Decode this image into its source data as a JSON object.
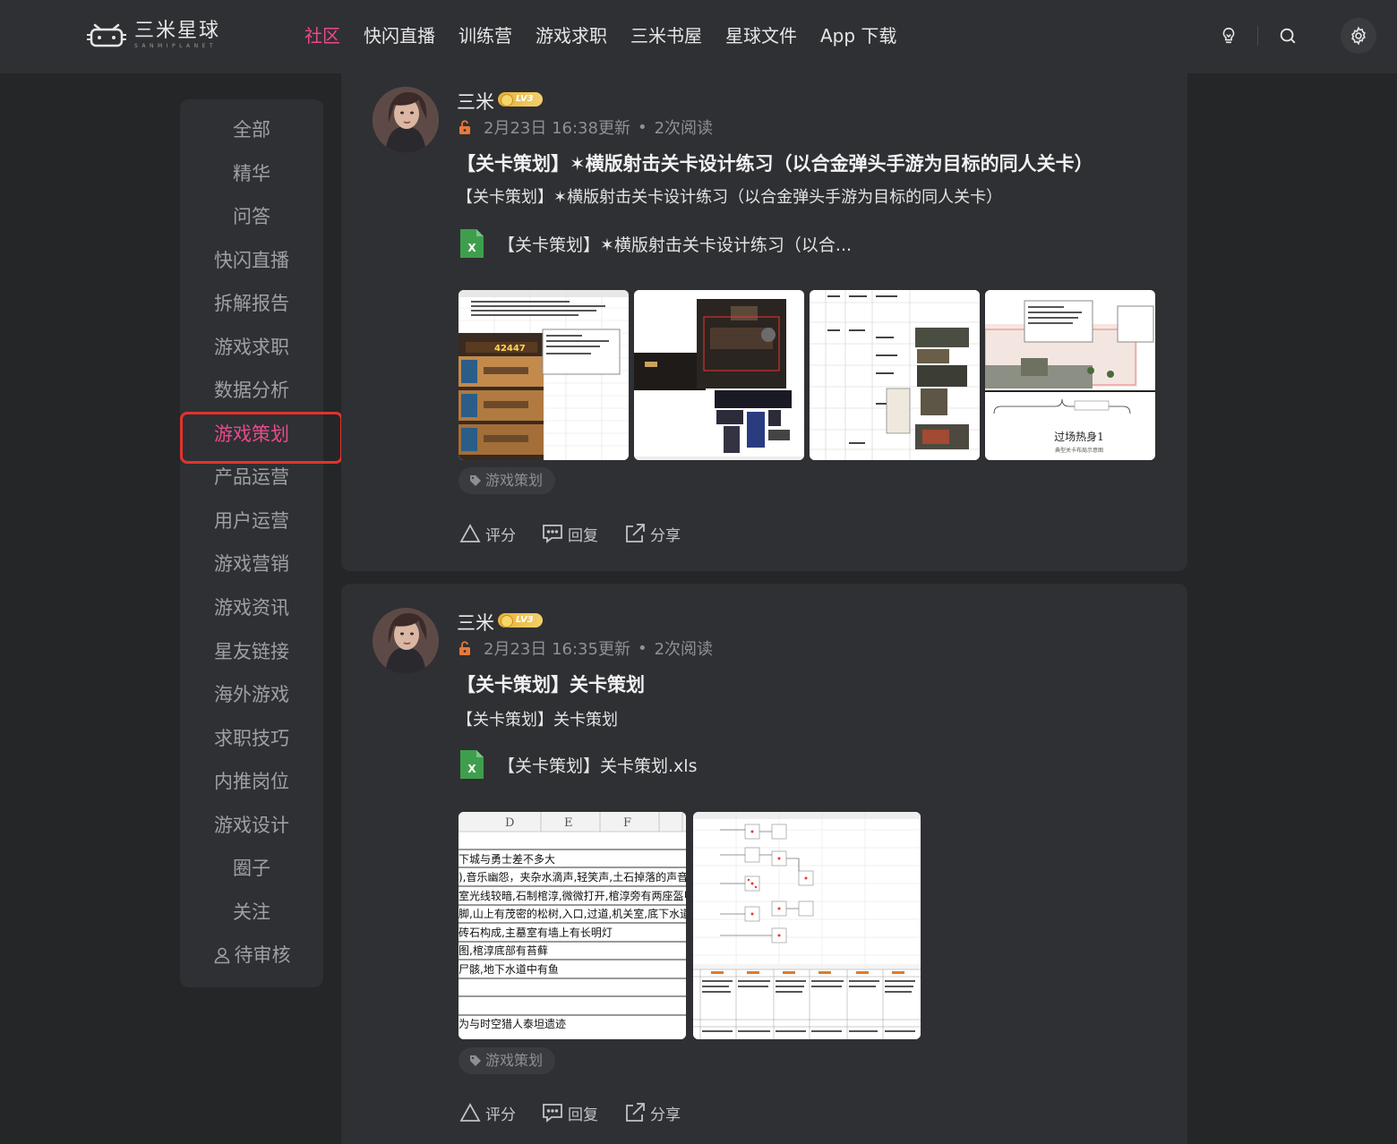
{
  "brand": {
    "name_cn": "三米星球",
    "name_en": "SANMIPLANET"
  },
  "nav": {
    "items": [
      "社区",
      "快闪直播",
      "训练营",
      "游戏求职",
      "三米书屋",
      "星球文件",
      "App 下载"
    ],
    "active_index": 0
  },
  "topbar_icons": [
    "bulb-icon",
    "search-icon",
    "gear-icon"
  ],
  "sidebar": {
    "items": [
      "全部",
      "精华",
      "问答",
      "快闪直播",
      "拆解报告",
      "游戏求职",
      "数据分析",
      "游戏策划",
      "产品运营",
      "用户运营",
      "游戏营销",
      "游戏资讯",
      "星友链接",
      "海外游戏",
      "求职技巧",
      "内推岗位",
      "游戏设计",
      "圈子",
      "关注",
      "待审核"
    ],
    "active_index": 7
  },
  "colors": {
    "accent": "#e94a8d",
    "highlight_border": "#e2332e",
    "xls_green": "#3f9e4d"
  },
  "posts": [
    {
      "author": "三米",
      "level": "LV3",
      "time": "2月23日 16:38更新",
      "reads": "2次阅读",
      "title": "【关卡策划】✶横版射击关卡设计练习（以合金弹头手游为目标的同人关卡）",
      "summary": "【关卡策划】✶横版射击关卡设计练习（以合金弹头手游为目标的同人关卡）",
      "file_name": "【关卡策划】✶横版射击关卡设计练习（以合...",
      "thumb_texts": [
        "42447",
        "过场热身1",
        "典型关卡布局示意图"
      ],
      "tag": "游戏策划",
      "actions": [
        "评分",
        "回复",
        "分享"
      ]
    },
    {
      "author": "三米",
      "level": "LV3",
      "time": "2月23日 16:35更新",
      "reads": "2次阅读",
      "title": "【关卡策划】关卡策划",
      "summary": "【关卡策划】关卡策划",
      "file_name": "【关卡策划】关卡策划.xls",
      "thumb_texts": {
        "cols": [
          "D",
          "E",
          "F"
        ],
        "rows": [
          "下城与勇士差不多大",
          "),音乐幽怨，夹杂水滴声,轻笑声,土石掉落的声音",
          "室光线较暗,石制棺淳,微微打开,棺淳旁有两座盔甲",
          "脚,山上有茂密的松树,入口,过道,机关室,底下水道",
          "砖石构成,主墓室有墙上有长明灯",
          "图,棺淳底部有苔藓",
          "尸骸,地下水道中有鱼",
          "",
          "",
          "为与时空猎人泰坦遗迹"
        ]
      },
      "tag": "游戏策划",
      "actions": [
        "评分",
        "回复",
        "分享"
      ]
    }
  ]
}
